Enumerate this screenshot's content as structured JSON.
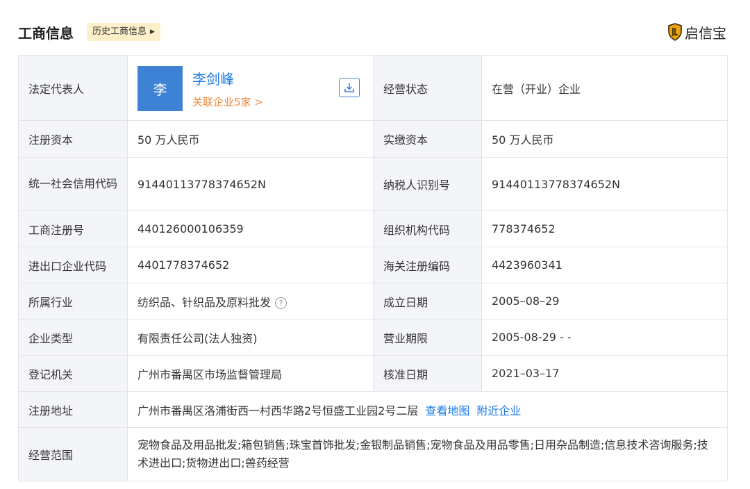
{
  "header": {
    "title": "工商信息",
    "history_btn": "历史工商信息",
    "brand": "启信宝"
  },
  "rep": {
    "label": "法定代表人",
    "avatar_char": "李",
    "name": "李剑峰",
    "related": "关联企业5家 >"
  },
  "rows": {
    "status_label": "经营状态",
    "status_value": "在营（开业）企业",
    "reg_capital_label": "注册资本",
    "reg_capital_value": "50 万人民币",
    "paid_capital_label": "实缴资本",
    "paid_capital_value": "50 万人民币",
    "credit_code_label": "统一社会信用代码",
    "credit_code_value": "91440113778374652N",
    "tax_id_label": "纳税人识别号",
    "tax_id_value": "91440113778374652N",
    "biz_reg_label": "工商注册号",
    "biz_reg_value": "440126000106359",
    "org_code_label": "组织机构代码",
    "org_code_value": "778374652",
    "import_export_label": "进出口企业代码",
    "import_export_value": "4401778374652",
    "customs_label": "海关注册编码",
    "customs_value": "4423960341",
    "industry_label": "所属行业",
    "industry_value": "纺织品、针织品及原料批发",
    "established_label": "成立日期",
    "established_value": "2005–08–29",
    "type_label": "企业类型",
    "type_value": "有限责任公司(法人独资)",
    "term_label": "营业期限",
    "term_value": "2005-08-29 - -",
    "authority_label": "登记机关",
    "authority_value": "广州市番禺区市场监督管理局",
    "approval_label": "核准日期",
    "approval_value": "2021–03–17",
    "address_label": "注册地址",
    "address_value": "广州市番禺区洛浦街西一村西华路2号恒盛工业园2号二层",
    "map_link": "查看地图",
    "nearby_link": "附近企业",
    "scope_label": "经营范围",
    "scope_value": "宠物食品及用品批发;箱包销售;珠宝首饰批发;金银制品销售;宠物食品及用品零售;日用杂品制造;信息技术咨询服务;技术进出口;货物进出口;兽药经营"
  },
  "icons": {
    "download": "download-icon",
    "help": "question-circle-icon",
    "brand": "shield-logo-icon",
    "history_arrow": "caret-right-icon"
  },
  "colors": {
    "link": "#1a7ae6",
    "related": "#f0883a",
    "avatar": "#3e82d6",
    "label_bg": "#f3f5f8",
    "history_bg": "#fdf0c8",
    "brand_gold": "#e8a317"
  }
}
